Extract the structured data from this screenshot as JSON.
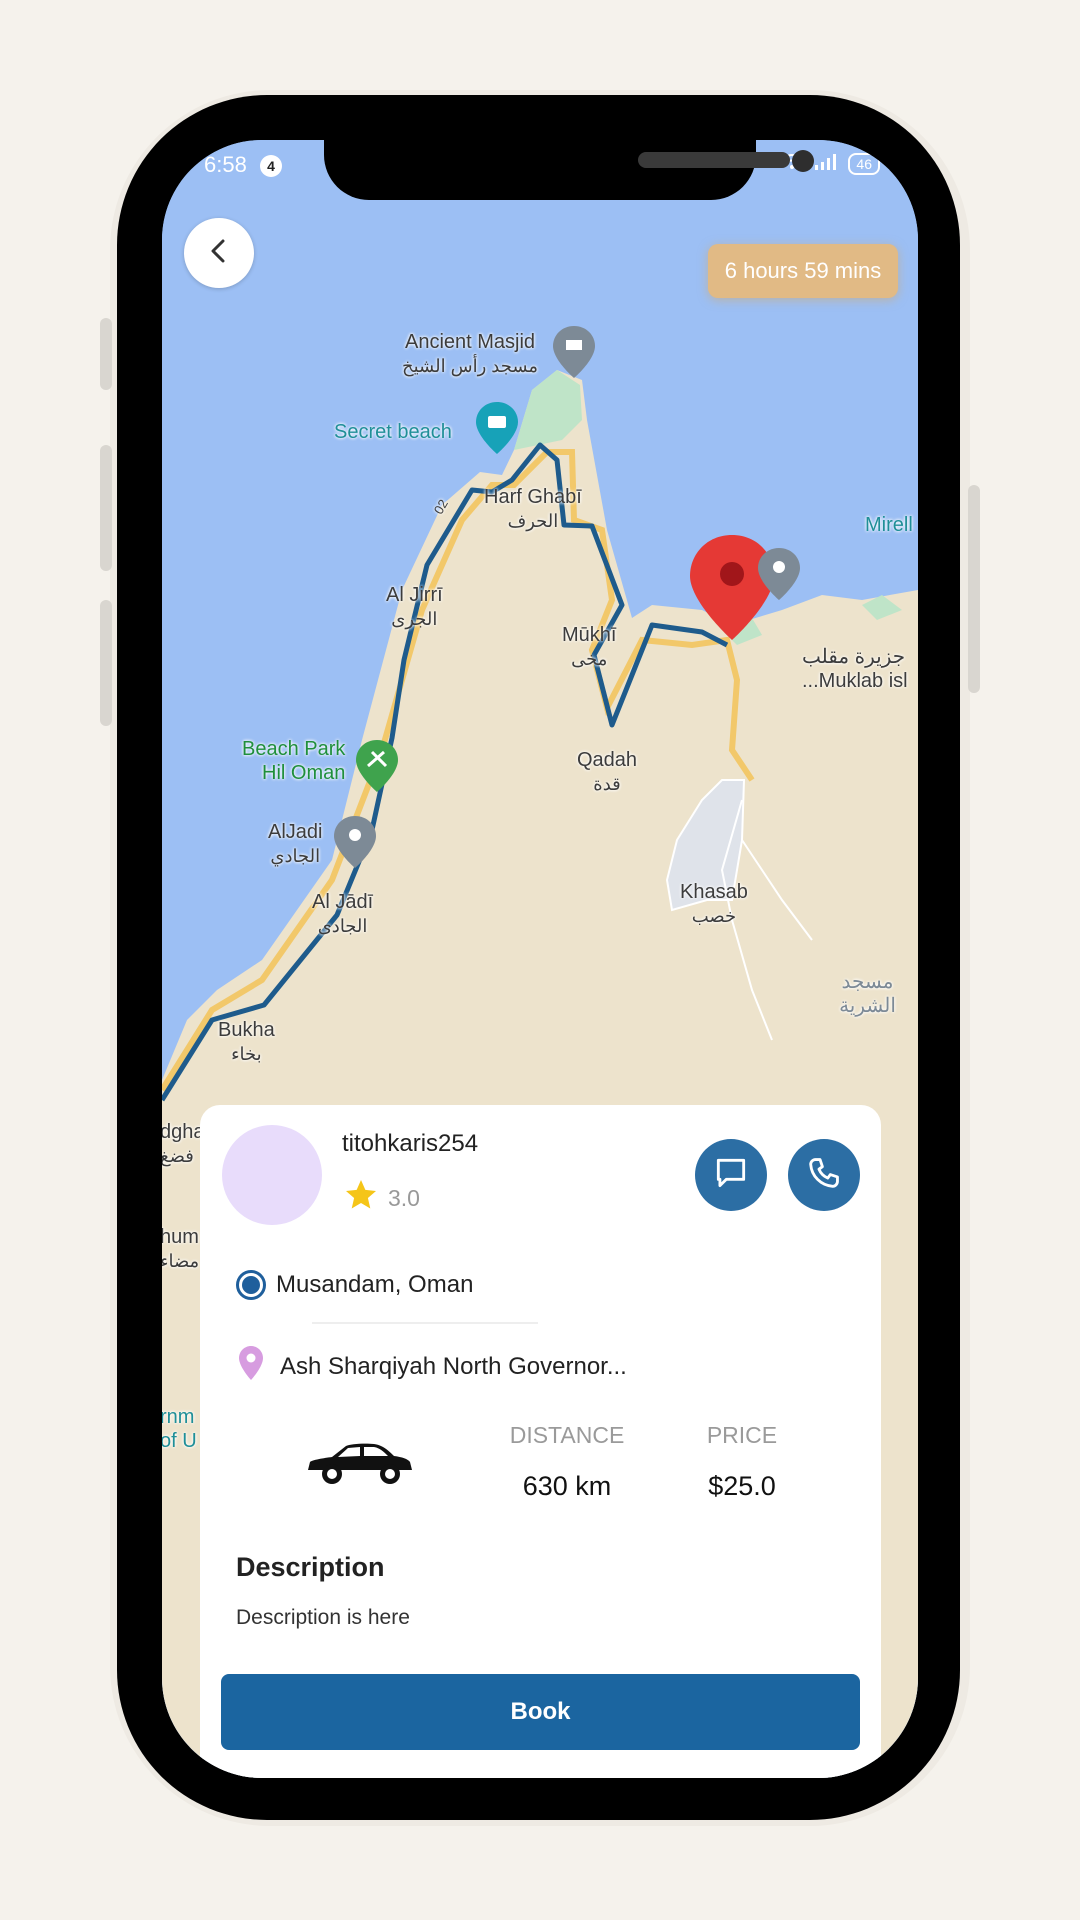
{
  "status_bar": {
    "time": "6:58",
    "notification_count": "4",
    "battery": "46"
  },
  "map": {
    "eta": "6 hours 59 mins",
    "labels": {
      "ancient_masjid": {
        "en": "Ancient Masjid",
        "ar": "مسجد رأس الشيخ"
      },
      "secret_beach": "Secret beach",
      "harf_ghabi": {
        "en": "Harf Ghabī",
        "ar": "الحرف"
      },
      "mirell": "Mirell",
      "al_jirri": {
        "en": "Al Jirrī",
        "ar": "الجرى"
      },
      "mukhi": {
        "en": "Mūkhī",
        "ar": "مخى"
      },
      "muklab": {
        "en": "...Muklab isl",
        "ar": "جزيرة مقلب"
      },
      "beach_park": {
        "line1": "Beach Park",
        "line2": "Hil Oman"
      },
      "qadah": {
        "en": "Qadah",
        "ar": "قدة"
      },
      "aljadi_poi": {
        "en": "AlJadi",
        "ar": "الجادي"
      },
      "al_jadi": {
        "en": "Al Jādī",
        "ar": "الجادى"
      },
      "khasab": {
        "en": "Khasab",
        "ar": "خصب"
      },
      "masjid_sharia": "مسجد الشرية",
      "bukha": {
        "en": "Bukha",
        "ar": "بخاء"
      },
      "edge1": {
        "en": "dgha",
        "ar": "فضغ"
      },
      "edge2": {
        "en": "hum",
        "ar": "مضاء"
      },
      "edge3": {
        "line1": "rnm",
        "line2": "of U"
      },
      "road_02": "02"
    }
  },
  "driver": {
    "username": "titohkaris254",
    "rating": "3.0"
  },
  "trip": {
    "pickup": "Musandam, Oman",
    "dropoff": "Ash Sharqiyah North Governor...",
    "distance_label": "DISTANCE",
    "distance_value": "630 km",
    "price_label": "PRICE",
    "price_value": "$25.0"
  },
  "description": {
    "title": "Description",
    "text": "Description is here"
  },
  "actions": {
    "book_label": "Book"
  },
  "colors": {
    "primary": "#1b65a0",
    "eta_bg": "#e1ba85",
    "route": "#1e5b8c",
    "sea": "#9cbff4",
    "land": "#ede3cc"
  }
}
